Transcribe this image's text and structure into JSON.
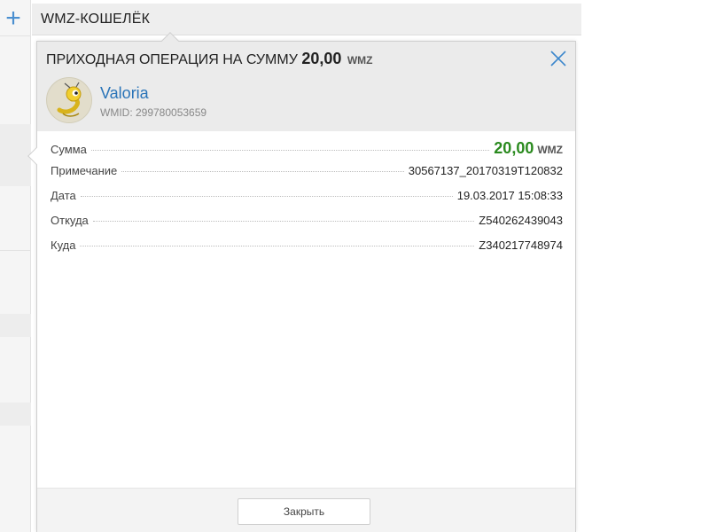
{
  "header": {
    "title": "WMZ-КОШЕЛЁК"
  },
  "dialog": {
    "title_prefix": "ПРИХОДНАЯ ОПЕРАЦИЯ НА СУММУ",
    "title_amount": "20,00",
    "title_currency": "WMZ",
    "peer": {
      "name": "Valoria",
      "wmid": "WMID: 299780053659"
    },
    "rows": [
      {
        "label": "Сумма",
        "value": "20,00",
        "currency": "WMZ"
      },
      {
        "label": "Примечание",
        "value": "30567137_20170319T120832"
      },
      {
        "label": "Дата",
        "value": "19.03.2017 15:08:33"
      },
      {
        "label": "Откуда",
        "value": "Z540262439043"
      },
      {
        "label": "Куда",
        "value": "Z340217748974"
      }
    ],
    "close_label": "Закрыть"
  },
  "colors": {
    "accent": "#2a74b8",
    "amount_green": "#2a8a1e",
    "plus_blue": "#4a8fd0"
  },
  "icons": {
    "add": "plus-icon",
    "close": "close-icon",
    "avatar": "webmoney-mascot-icon"
  }
}
